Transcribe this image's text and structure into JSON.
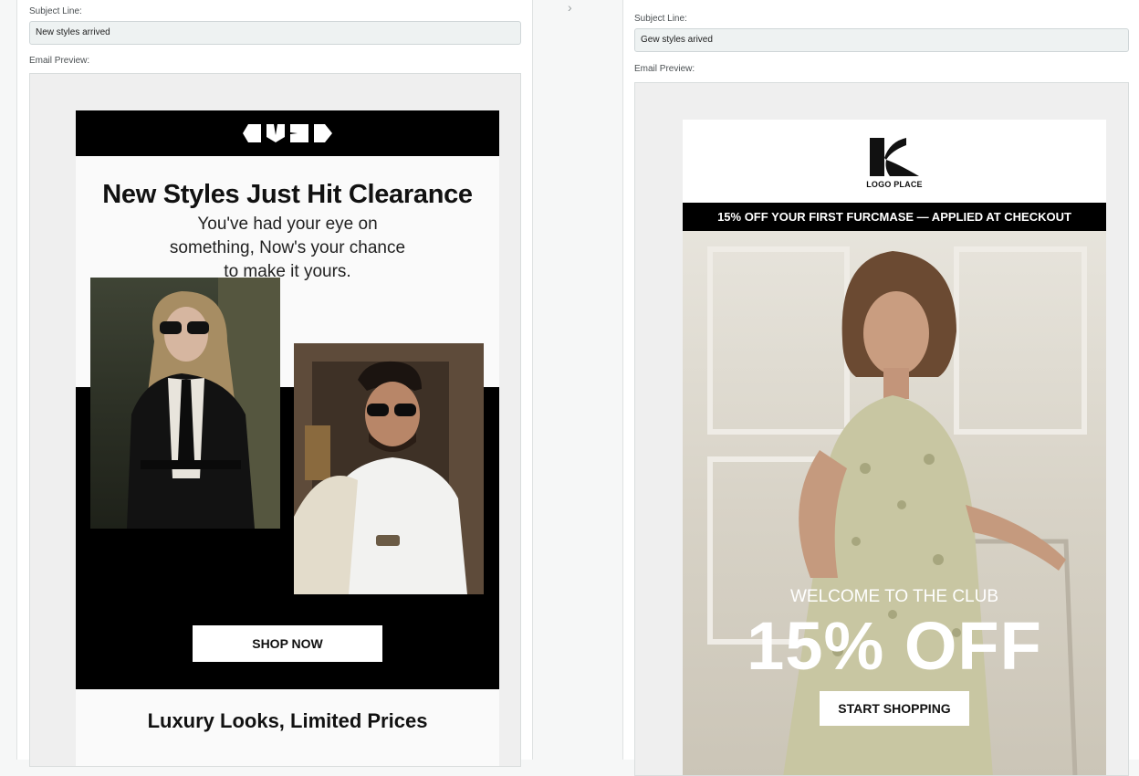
{
  "left": {
    "subject_label": "Subject Line:",
    "subject_value": "New styles arrived",
    "preview_label": "Email Preview:",
    "email": {
      "brand_icon": "brand-logo-glyphs",
      "title": "New Styles Just Hit Clearance",
      "subtitle": "You've had your eye on something, Now's your chance to make it yours.",
      "cta": "SHOP NOW",
      "footer_title": "Luxury Looks, Limited Prices",
      "photo_1": "woman-in-sunglasses-photo",
      "photo_2": "man-in-sunglasses-photo"
    }
  },
  "right": {
    "subject_label": "Subject Line:",
    "subject_value": "Gew styles arived",
    "preview_label": "Email Preview:",
    "email": {
      "logo_icon": "logo-k-mark-icon",
      "logo_text": "LOGO PLACE",
      "promo_bar": "15% OFF YOUR FIRST FURCMASE — APPLIED AT CHECKOUT",
      "hero_photo": "woman-seated-floral-dress-photo",
      "kicker": "WELCOME TO THE CLUB",
      "headline": "15% OFF",
      "cta": "START SHOPPING"
    }
  },
  "divider_icon": "chevron-right-icon",
  "colors": {
    "email_black": "#000000",
    "input_bg": "#eef2f2",
    "panel_bg": "#ffffff"
  }
}
